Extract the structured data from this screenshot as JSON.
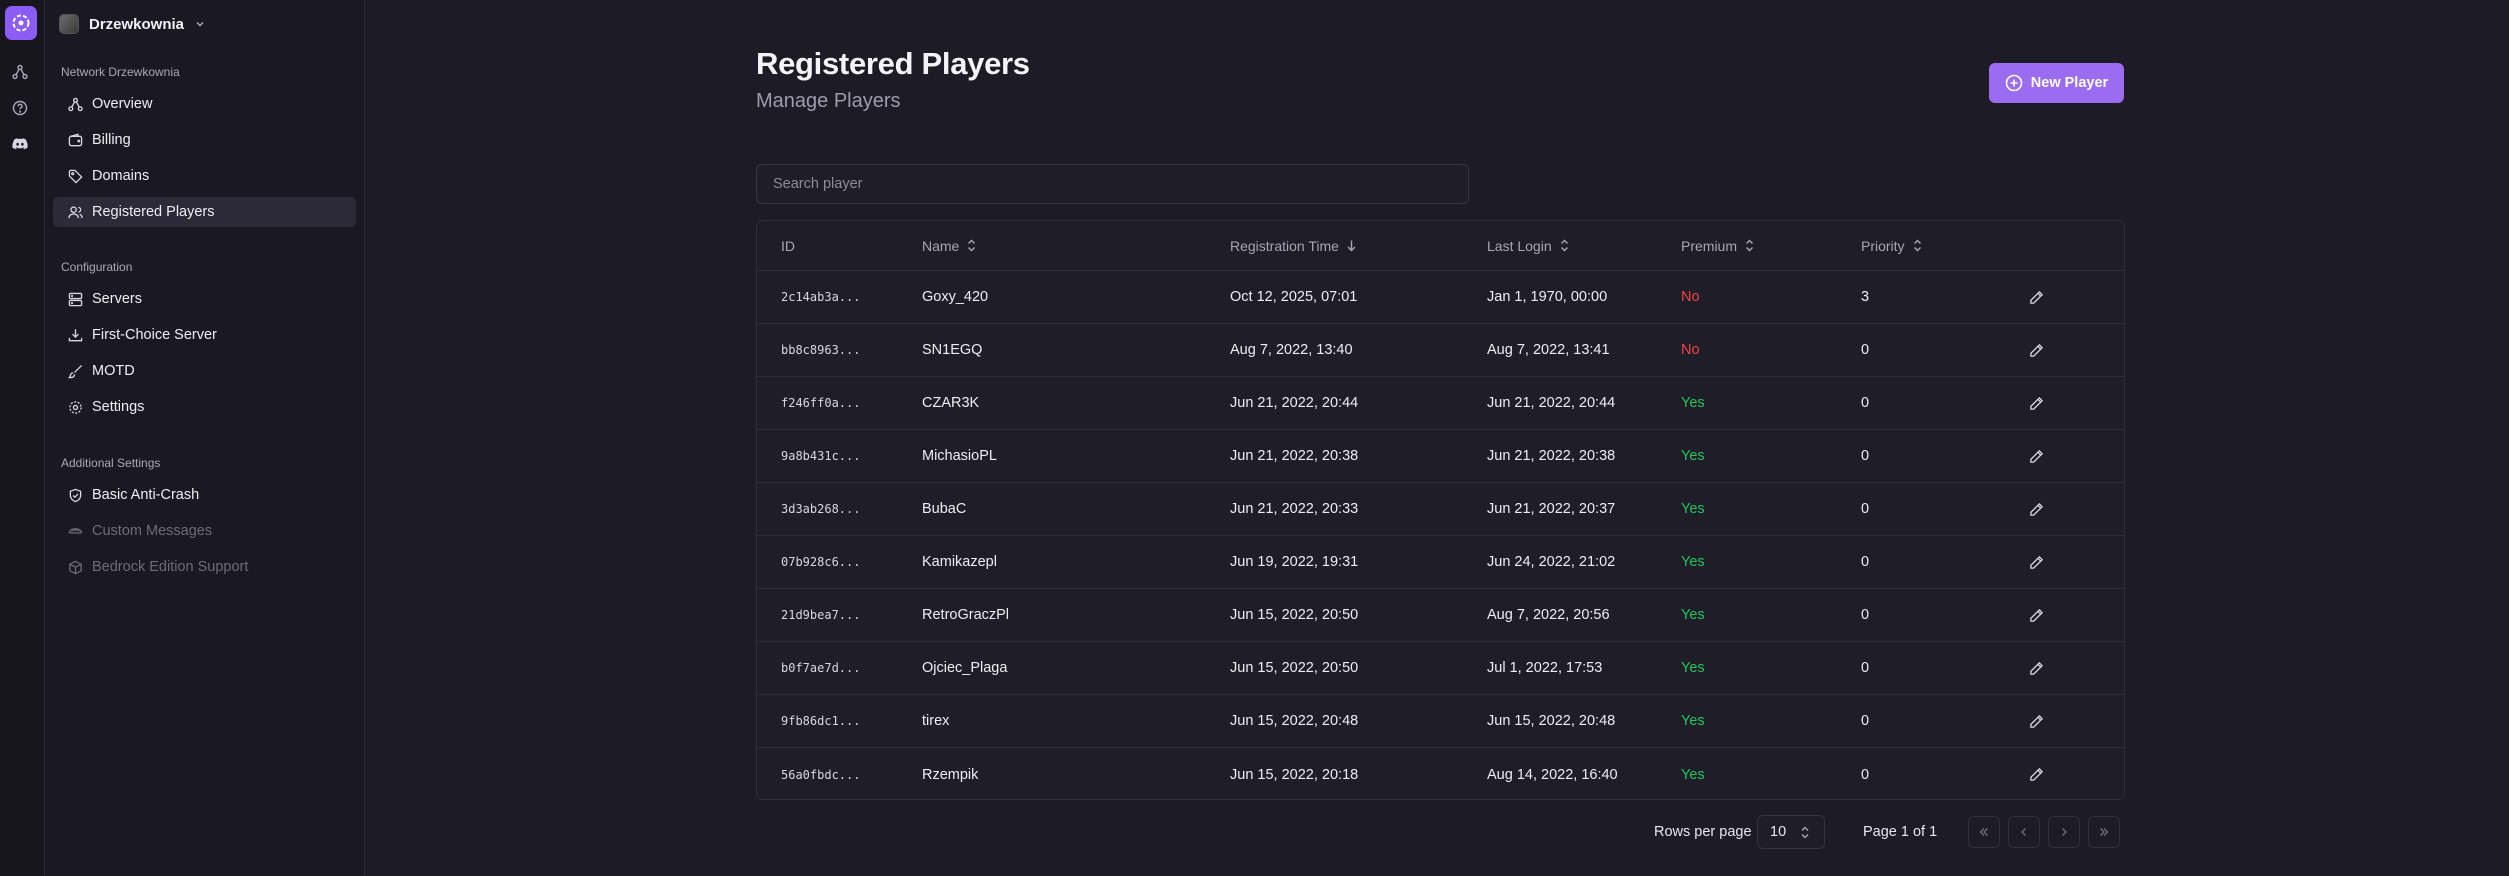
{
  "rail": {
    "icons": [
      "network-icon",
      "help-circle-icon",
      "discord-icon"
    ]
  },
  "sidebar": {
    "org_name": "Drzewkownia",
    "network_label": "Network Drzewkownia",
    "network_items": [
      {
        "label": "Overview",
        "icon": "network-icon"
      },
      {
        "label": "Billing",
        "icon": "wallet-icon"
      },
      {
        "label": "Domains",
        "icon": "tag-icon"
      },
      {
        "label": "Registered Players",
        "icon": "users-icon",
        "active": true
      }
    ],
    "configuration_label": "Configuration",
    "configuration_items": [
      {
        "label": "Servers",
        "icon": "server-icon"
      },
      {
        "label": "First-Choice Server",
        "icon": "download-icon"
      },
      {
        "label": "MOTD",
        "icon": "brush-icon"
      },
      {
        "label": "Settings",
        "icon": "gear-icon"
      }
    ],
    "additional_label": "Additional Settings",
    "additional_items": [
      {
        "label": "Basic Anti-Crash",
        "icon": "shield-icon",
        "disabled": false
      },
      {
        "label": "Custom Messages",
        "icon": "messages-icon",
        "disabled": true
      },
      {
        "label": "Bedrock Edition Support",
        "icon": "box-icon",
        "disabled": true
      }
    ]
  },
  "header": {
    "title": "Registered Players",
    "subtitle": "Manage Players",
    "new_button": "New Player"
  },
  "search": {
    "placeholder": "Search player",
    "value": ""
  },
  "table": {
    "columns": {
      "id": "ID",
      "name": "Name",
      "registration": "Registration Time",
      "last_login": "Last Login",
      "premium": "Premium",
      "priority": "Priority"
    },
    "rows": [
      {
        "id": "2c14ab3a...",
        "name": "Goxy_420",
        "registration": "Oct 12, 2025, 07:01",
        "last_login": "Jan 1, 1970, 00:00",
        "premium": "No",
        "priority": "3"
      },
      {
        "id": "bb8c8963...",
        "name": "SN1EGQ",
        "registration": "Aug 7, 2022, 13:40",
        "last_login": "Aug 7, 2022, 13:41",
        "premium": "No",
        "priority": "0"
      },
      {
        "id": "f246ff0a...",
        "name": "CZAR3K",
        "registration": "Jun 21, 2022, 20:44",
        "last_login": "Jun 21, 2022, 20:44",
        "premium": "Yes",
        "priority": "0"
      },
      {
        "id": "9a8b431c...",
        "name": "MichasioPL",
        "registration": "Jun 21, 2022, 20:38",
        "last_login": "Jun 21, 2022, 20:38",
        "premium": "Yes",
        "priority": "0"
      },
      {
        "id": "3d3ab268...",
        "name": "BubaC",
        "registration": "Jun 21, 2022, 20:33",
        "last_login": "Jun 21, 2022, 20:37",
        "premium": "Yes",
        "priority": "0"
      },
      {
        "id": "07b928c6...",
        "name": "Kamikazepl",
        "registration": "Jun 19, 2022, 19:31",
        "last_login": "Jun 24, 2022, 21:02",
        "premium": "Yes",
        "priority": "0"
      },
      {
        "id": "21d9bea7...",
        "name": "RetroGraczPl",
        "registration": "Jun 15, 2022, 20:50",
        "last_login": "Aug 7, 2022, 20:56",
        "premium": "Yes",
        "priority": "0"
      },
      {
        "id": "b0f7ae7d...",
        "name": "Ojciec_Plaga",
        "registration": "Jun 15, 2022, 20:50",
        "last_login": "Jul 1, 2022, 17:53",
        "premium": "Yes",
        "priority": "0"
      },
      {
        "id": "9fb86dc1...",
        "name": "tirex",
        "registration": "Jun 15, 2022, 20:48",
        "last_login": "Jun 15, 2022, 20:48",
        "premium": "Yes",
        "priority": "0"
      },
      {
        "id": "56a0fbdc...",
        "name": "Rzempik",
        "registration": "Jun 15, 2022, 20:18",
        "last_login": "Aug 14, 2022, 16:40",
        "premium": "Yes",
        "priority": "0"
      }
    ]
  },
  "pagination": {
    "rows_per_page_label": "Rows per page",
    "rows_per_page": "10",
    "page_info": "Page 1 of 1"
  },
  "colors": {
    "accent": "#9b6cf0",
    "yes": "#22c55e",
    "no": "#ef4444",
    "background": "#1c1b26"
  }
}
